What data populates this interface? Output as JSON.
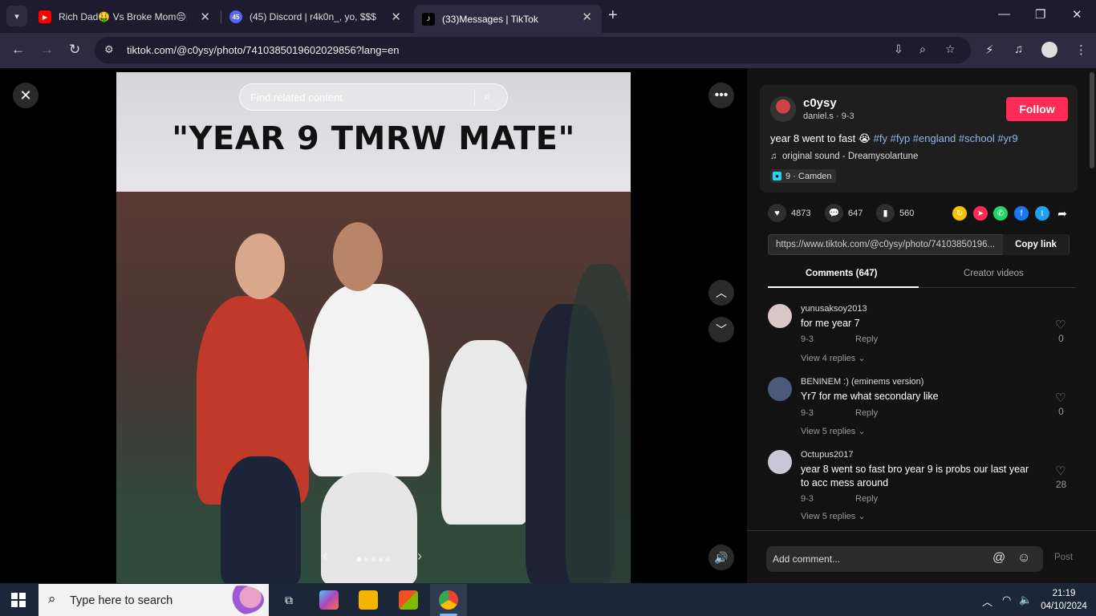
{
  "browser": {
    "tabs": [
      {
        "title": "Rich Dad🤑 Vs Broke Mom😔|",
        "favicon": "youtube-icon",
        "color": "#ff0000"
      },
      {
        "title": "(45) Discord | r4k0n_, yo, $$$",
        "favicon": "discord-icon",
        "color": "#5865f2",
        "badge": "45"
      },
      {
        "title": "(33)Messages | TikTok",
        "favicon": "tiktok-icon",
        "color": "#000000",
        "active": true
      }
    ],
    "url": "tiktok.com/@c0ysy/photo/7410385019602029856?lang=en"
  },
  "viewer": {
    "search_placeholder": "Find related content",
    "photo_caption": "\"YEAR 9 TMRW MATE\"",
    "slide_count": 5,
    "active_slide": 0
  },
  "post": {
    "username": "c0ysy",
    "display_meta": "daniel.s · 9-3",
    "follow_label": "Follow",
    "description_text": "year 8 went to fast 😭",
    "hashtags": "#fy #fyp #england #school #yr9",
    "sound": "original sound - Dreamysolartune",
    "location": "9 · Camden",
    "likes": "4873",
    "comments_count": "647",
    "saves": "560",
    "link": "https://www.tiktok.com/@c0ysy/photo/74103850196...",
    "copy_label": "Copy link"
  },
  "tabs": {
    "comments": "Comments (647)",
    "creator_videos": "Creator videos"
  },
  "comments": [
    {
      "user": "yunusaksoy2013",
      "text": "for me year 7",
      "date": "9-3",
      "reply": "Reply",
      "view_replies": "View 4 replies",
      "likes": "0",
      "avatar_color": "#d9c7c7"
    },
    {
      "user": "BENINEM :) (eminems version)",
      "text": "Yr7 for me what secondary like",
      "date": "9-3",
      "reply": "Reply",
      "view_replies": "View 5 replies",
      "likes": "0",
      "avatar_color": "#4a5a7a"
    },
    {
      "user": "Octupus2017",
      "text": "year 8 went so fast bro year 9 is probs our last year to acc mess around",
      "date": "9-3",
      "reply": "Reply",
      "view_replies": "View 5 replies",
      "likes": "28",
      "avatar_color": "#c8c8d8"
    }
  ],
  "comment_bar": {
    "placeholder": "Add comment...",
    "post_label": "Post"
  },
  "taskbar": {
    "search_text": "Type here to search",
    "time": "21:19",
    "date": "04/10/2024"
  }
}
